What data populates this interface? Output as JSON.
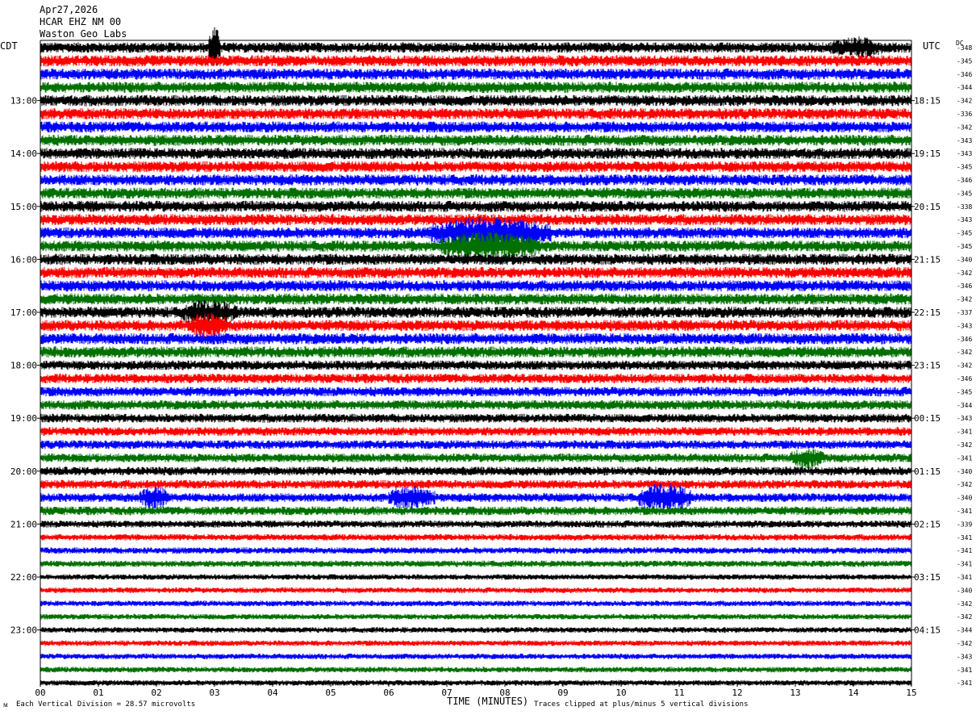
{
  "header": {
    "date": "Apr27,2026",
    "station": "HCAR EHZ NM 00",
    "source": "Waston Geo Labs",
    "left_tz": "CDT",
    "right_tz": "UTC",
    "dc_label": "DC"
  },
  "footer": {
    "scale_note": "Each Vertical Division =   28.57 microvolts",
    "clip_note": "Traces clipped at plus/minus 5 vertical divisions",
    "corner_mark": "ᴍ"
  },
  "colors": {
    "trace_cycle": [
      "#000000",
      "#ff0000",
      "#0000ff",
      "#007000"
    ]
  },
  "chart_data": {
    "type": "line",
    "xlabel": "TIME (MINUTES)",
    "xlim": [
      0,
      15
    ],
    "x_ticks": [
      "00",
      "01",
      "02",
      "03",
      "04",
      "05",
      "06",
      "07",
      "08",
      "09",
      "10",
      "11",
      "12",
      "13",
      "14",
      "15"
    ],
    "hour_labels_left": [
      "13:00",
      "14:00",
      "15:00",
      "16:00",
      "17:00",
      "18:00",
      "19:00",
      "20:00",
      "21:00",
      "22:00",
      "23:00"
    ],
    "hour_labels_right": [
      "18:15",
      "19:15",
      "20:15",
      "21:15",
      "22:15",
      "23:15",
      "00:15",
      "01:15",
      "02:15",
      "03:15",
      "04:15"
    ],
    "first_hour_row": 4,
    "rows_per_hour": 4,
    "dc_offsets": [
      "-348",
      "-345",
      "-346",
      "-344",
      "-342",
      "-336",
      "-342",
      "-343",
      "-343",
      "-345",
      "-346",
      "-345",
      "-338",
      "-343",
      "-345",
      "-345",
      "-340",
      "-342",
      "-346",
      "-342",
      "-337",
      "-343",
      "-346",
      "-342",
      "-342",
      "-346",
      "-345",
      "-344",
      "-343",
      "-341",
      "-342",
      "-341",
      "-340",
      "-342",
      "-340",
      "-341",
      "-339",
      "-341",
      "-341",
      "-341",
      "-341",
      "-340",
      "-342",
      "-342",
      "-344",
      "-342",
      "-343",
      "-341",
      "-341"
    ],
    "row_noise": [
      6.5,
      7,
      7,
      7,
      7,
      7,
      7,
      7,
      7,
      7,
      7,
      7,
      7,
      7,
      7,
      7,
      7,
      7,
      7,
      7,
      7,
      7,
      7,
      7,
      6,
      6,
      6,
      6,
      5.5,
      5.5,
      5.5,
      5.5,
      5.5,
      5.5,
      5.5,
      5.5,
      4.5,
      4,
      4,
      4,
      3.5,
      3.5,
      3.5,
      3.5,
      3.5,
      3.5,
      3.5,
      3.5,
      3.5
    ],
    "events": [
      {
        "row": 14,
        "start_min": 6.7,
        "end_min": 8.8,
        "amp": 20
      },
      {
        "row": 15,
        "start_min": 6.9,
        "end_min": 8.6,
        "amp": 18
      },
      {
        "row": 20,
        "start_min": 2.4,
        "end_min": 3.4,
        "amp": 16
      },
      {
        "row": 21,
        "start_min": 2.6,
        "end_min": 3.2,
        "amp": 18
      },
      {
        "row": 34,
        "start_min": 1.7,
        "end_min": 2.2,
        "amp": 15
      },
      {
        "row": 34,
        "start_min": 6.0,
        "end_min": 6.8,
        "amp": 15
      },
      {
        "row": 34,
        "start_min": 10.3,
        "end_min": 11.2,
        "amp": 18
      },
      {
        "row": 31,
        "start_min": 12.9,
        "end_min": 13.5,
        "amp": 13
      },
      {
        "row": 0,
        "start_min": 13.6,
        "end_min": 14.5,
        "amp": 14
      },
      {
        "row": 0,
        "start_min": 2.9,
        "end_min": 3.1,
        "amp": 26
      }
    ]
  }
}
